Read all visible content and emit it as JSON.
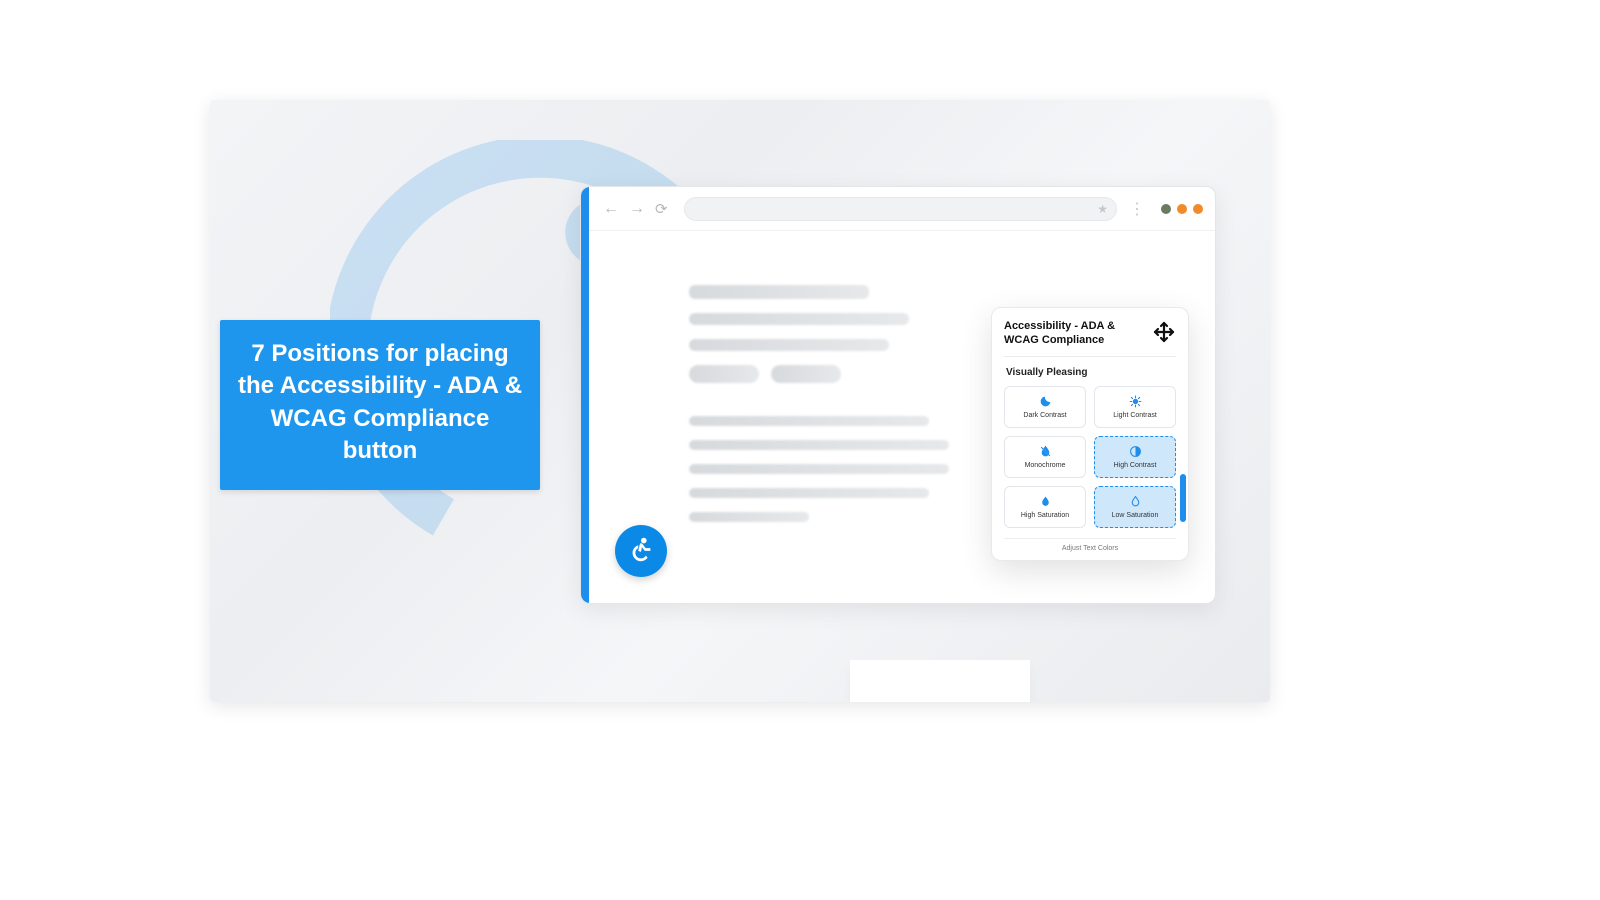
{
  "headline": "7 Positions for placing the Accessibility - ADA & WCAG Compliance button",
  "panel": {
    "title": "Accessibility - ADA & WCAG Compliance",
    "section": "Visually Pleasing",
    "options": [
      {
        "label": "Dark Contrast",
        "icon": "moon",
        "selected": false
      },
      {
        "label": "Light Contrast",
        "icon": "sun",
        "selected": false
      },
      {
        "label": "Monochrome",
        "icon": "droplet-off",
        "selected": false
      },
      {
        "label": "High Contrast",
        "icon": "contrast",
        "selected": true
      },
      {
        "label": "High Saturation",
        "icon": "droplet",
        "selected": false
      },
      {
        "label": "Low Saturation",
        "icon": "droplet-open",
        "selected": true
      }
    ],
    "truncated_row_label": "Adjust Text Colors"
  },
  "icons": {
    "back": "←",
    "forward": "→",
    "reload": "⟳",
    "star": "★",
    "kebab": "⋮"
  },
  "window_buttons": [
    "green",
    "orange",
    "orange"
  ]
}
